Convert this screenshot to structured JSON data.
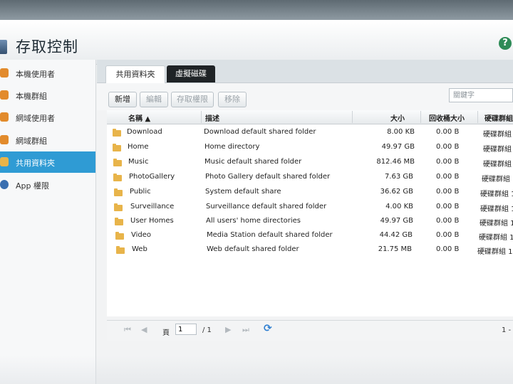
{
  "app": {
    "title": "存取控制",
    "help_icon": "?"
  },
  "sidebar": {
    "items": [
      {
        "label": "本機使用者",
        "icon": "user-icon",
        "color": "#e28b2c"
      },
      {
        "label": "本機群組",
        "icon": "group-icon",
        "color": "#e28b2c"
      },
      {
        "label": "網域使用者",
        "icon": "domain-user-icon",
        "color": "#e28b2c"
      },
      {
        "label": "網域群組",
        "icon": "domain-group-icon",
        "color": "#e28b2c"
      },
      {
        "label": "共用資料夾",
        "icon": "shared-folder-icon",
        "color": "#e8b44a",
        "active": true
      },
      {
        "label": "App 權限",
        "icon": "app-permission-icon",
        "color": "#3a6fb0"
      }
    ]
  },
  "tabs": [
    "共用資料夾",
    "虛擬磁碟"
  ],
  "toolbar": {
    "add": "新增",
    "edit": "編輯",
    "access": "存取權限",
    "remove": "移除",
    "search_placeholder": "關鍵字"
  },
  "columns": {
    "name": "名稱 ▲",
    "desc": "描述",
    "size": "大小",
    "recycle": "回收桶大小",
    "disk": "硬碟群組"
  },
  "rows": [
    {
      "name": "Download",
      "desc": "Download default shared folder",
      "size": "8.00 KB",
      "recycle": "0.00 B",
      "disk": "硬碟群組"
    },
    {
      "name": "Home",
      "desc": "Home directory",
      "size": "49.97 GB",
      "recycle": "0.00 B",
      "disk": "硬碟群組"
    },
    {
      "name": "Music",
      "desc": "Music default shared folder",
      "size": "812.46 MB",
      "recycle": "0.00 B",
      "disk": "硬碟群組"
    },
    {
      "name": "PhotoGallery",
      "desc": "Photo Gallery default shared folder",
      "size": "7.63 GB",
      "recycle": "0.00 B",
      "disk": "硬碟群組"
    },
    {
      "name": "Public",
      "desc": "System default share",
      "size": "36.62 GB",
      "recycle": "0.00 B",
      "disk": "硬碟群組 1"
    },
    {
      "name": "Surveillance",
      "desc": "Surveillance default shared folder",
      "size": "4.00 KB",
      "recycle": "0.00 B",
      "disk": "硬碟群組 1"
    },
    {
      "name": "User Homes",
      "desc": "All users' home directories",
      "size": "49.97 GB",
      "recycle": "0.00 B",
      "disk": "硬碟群組 1"
    },
    {
      "name": "Video",
      "desc": "Media Station default shared folder",
      "size": "44.42 GB",
      "recycle": "0.00 B",
      "disk": "硬碟群組 1"
    },
    {
      "name": "Web",
      "desc": "Web default shared folder",
      "size": "21.75 MB",
      "recycle": "0.00 B",
      "disk": "硬碟群組 1"
    }
  ],
  "pager": {
    "page_label": "頁",
    "page_value": "1",
    "total": "/ 1",
    "range": "1 -"
  }
}
